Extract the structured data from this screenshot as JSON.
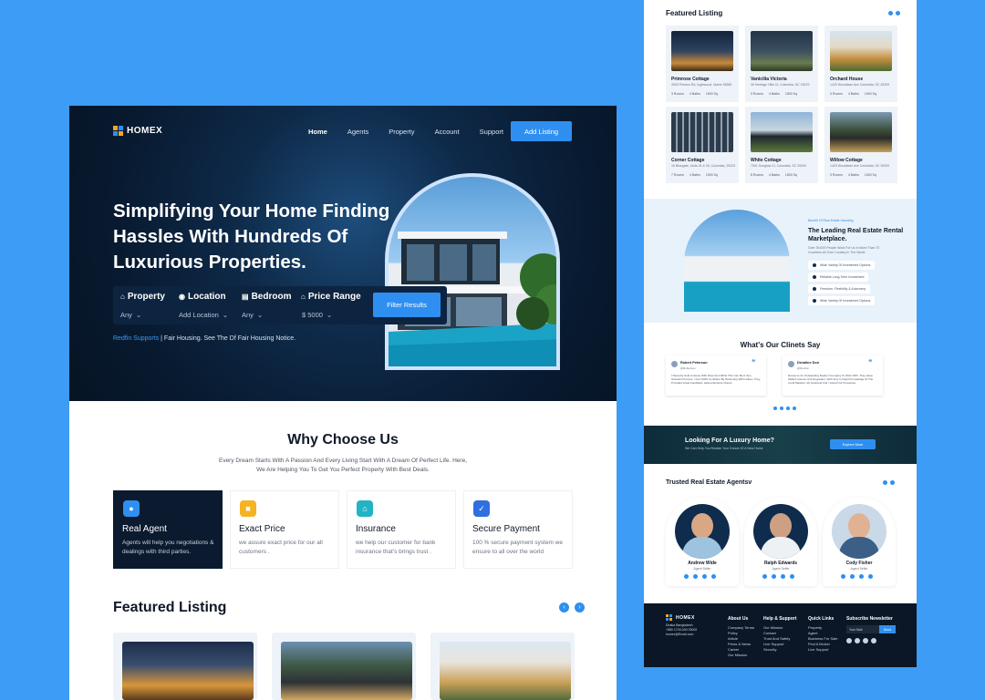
{
  "brand": {
    "name": "HOMEX",
    "colors": {
      "accent": "#2f8ff0",
      "dark": "#081a30",
      "background": "#3d9cf5"
    }
  },
  "nav": {
    "items": [
      "Home",
      "Agents",
      "Property",
      "Account",
      "Support"
    ],
    "cta": "Add Listing"
  },
  "hero": {
    "title": "Simplifying Your Home Finding Hassles With Hundreds Of Luxurious Properties.",
    "search": {
      "property": {
        "label": "Property",
        "value": "Any"
      },
      "location": {
        "label": "Location",
        "value": "Add Location"
      },
      "bedroom": {
        "label": "Bedroom",
        "value": "Any"
      },
      "price": {
        "label": "Price Range",
        "value": "$ 5000"
      },
      "button": "Filter Results"
    },
    "support_link": "Redfin Supports",
    "support_text": "Fair Housing. See The Df Fair Housing Notice."
  },
  "why": {
    "title": "Why Choose Us",
    "subtitle": "Every Dream Starts With A Passion And Every Living Start With A Dream Of Perfect Life. Here, We Are Helping You To Get You Perfect Property With Best Deals.",
    "cards": [
      {
        "title": "Real Agent",
        "text": "Agents will help you negotiations & dealings with third parties.",
        "icon": "user-icon"
      },
      {
        "title": "Exact Price",
        "text": "we assure exact price for our all customers .",
        "icon": "price-tag-icon"
      },
      {
        "title": "Insurance",
        "text": "we help our customer for bank insurance that's brings trust .",
        "icon": "home-shield-icon"
      },
      {
        "title": "Secure Payment",
        "text": "100 % secure payment system we ensure to all over the world",
        "icon": "shield-check-icon"
      }
    ]
  },
  "featured": {
    "title": "Featured Listing"
  },
  "right": {
    "featured_title": "Featured Listing",
    "listings": [
      {
        "name": "Primrose Cottage",
        "addr": "3000 Preston Rd, Inglewood, Maine 98380",
        "stats": [
          "3 Rooms",
          "4 Baths",
          "1500 Sq"
        ]
      },
      {
        "name": "Vanicilia Victoria",
        "addr": "26 Heritage Hills Ct, Columbia, SC 29229",
        "stats": [
          "3 Rooms",
          "4 Baths",
          "1500 Sq"
        ]
      },
      {
        "name": "Orchard House",
        "addr": "1420 Woodlawn Ave Columbia, SC 29209",
        "stats": [
          "3 Rooms",
          "4 Baths",
          "1500 Sq"
        ]
      },
      {
        "name": "Corner Cottage",
        "addr": "16 Bluegate, Units 24 & 26, Columbia, 29223",
        "stats": [
          "7 Rooms",
          "4 Baths",
          "1500 Sq"
        ]
      },
      {
        "name": "White Cottage",
        "addr": "7901 Sunglow Ct, Columbia, SC 29209",
        "stats": [
          "8 Rooms",
          "4 Baths",
          "1500 Sq"
        ]
      },
      {
        "name": "Willow Cottage",
        "addr": "1420 Woodlawn Ave Columbia, SC 29209",
        "stats": [
          "3 Rooms",
          "4 Baths",
          "1500 Sq"
        ]
      }
    ],
    "about": {
      "eyebrow": "Benefit Of Real Estate Investing",
      "title": "The Leading Real Estate Rental Marketplace.",
      "text": "Over 39,000 People Work For Us In More Than 70 Countries All Over Country In The World.",
      "features": [
        "Wide Variety Of Investment Options",
        "Reliable Long-Term Investment",
        "Freedom, Flexibility & Autonomy",
        "Wide Variety Of Investment Options"
      ]
    },
    "testimonials": {
      "title": "What's Our Clinets Say",
      "items": [
        {
          "name": "Robert Peterson",
          "role": "@Robertson",
          "text": "I Recently Sold A House With Dave And While This Can Be A Very Stressful Process, I Felt 100% Confident By Partnering With Hubes. They Provided Great Feedback, Helped Explore Clients."
        },
        {
          "name": "Devaline Don",
          "role": "@Devlion",
          "text": "Dames Is An Outstanding Dealer! Company To Work With. They Have Skilled Listener And Negotiator, With Very In Depth Knowledge Of The Local Markets. My Husband And I Listed Our Properties."
        }
      ]
    },
    "cta": {
      "title": "Looking For A Luxury Home?",
      "text": "We Can Help You Realize Your Dream Of A New Home",
      "button": "Explore More"
    },
    "agents": {
      "title": "Trusted Real Estate Agentsv",
      "items": [
        {
          "name": "Andrew Wide",
          "role": "Agent Seller"
        },
        {
          "name": "Ralph Edwards",
          "role": "Agent Seller"
        },
        {
          "name": "Cody Fisher",
          "role": "Agent Seller"
        }
      ]
    },
    "footer": {
      "brand": "HOMEX",
      "address": "Dhaka Bangladesh",
      "phone": "+880 1700-000 00002",
      "email": "homex@Email.com",
      "about": {
        "title": "About Us",
        "links": [
          "Company Terms",
          "Policy",
          "Article",
          "Press & News",
          "Career",
          "Our Mission"
        ]
      },
      "help": {
        "title": "Help & Support",
        "links": [
          "Our Mission",
          "Contact",
          "Trust And Safety",
          "Live Support",
          "Security"
        ]
      },
      "quick": {
        "title": "Quick Links",
        "links": [
          "Property",
          "Agent",
          "Business For Sale",
          "Find A Broker",
          "Live Support"
        ]
      },
      "newsletter": {
        "title": "Subscribe Newsletter",
        "placeholder": "Your Mail",
        "button": "Send"
      }
    }
  }
}
